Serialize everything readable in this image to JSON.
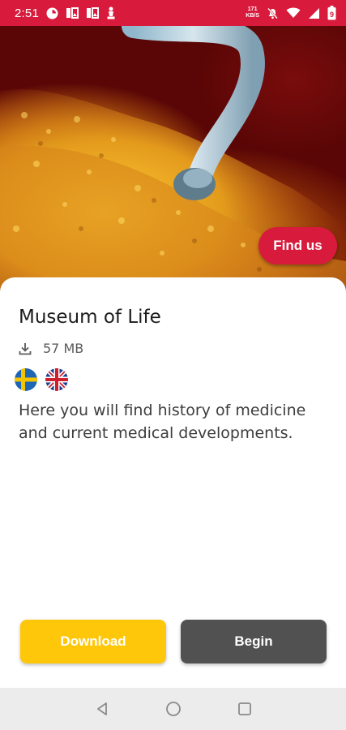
{
  "status_bar": {
    "time": "2:51",
    "net_speed_value": "171",
    "net_speed_unit": "KB/S",
    "battery_level": "9",
    "icons": [
      "app-notification-icon",
      "gallery-icon",
      "gallery-icon",
      "chess-icon",
      "net-speed",
      "mute-icon",
      "wifi-icon",
      "signal-icon",
      "battery-icon"
    ]
  },
  "hero": {
    "find_us_label": "Find us",
    "colors": {
      "accent": "#d81b3c"
    }
  },
  "museum": {
    "title": "Museum of Life",
    "download_size": "57 MB",
    "languages": [
      "sweden-flag",
      "uk-flag"
    ],
    "description": "Here you will find history of medicine and current medical developments."
  },
  "actions": {
    "download_label": "Download",
    "begin_label": "Begin",
    "colors": {
      "download": "#ffc70a",
      "begin": "#515151"
    }
  },
  "nav_bar": {
    "buttons": [
      "back-icon",
      "home-icon",
      "recents-icon"
    ]
  }
}
